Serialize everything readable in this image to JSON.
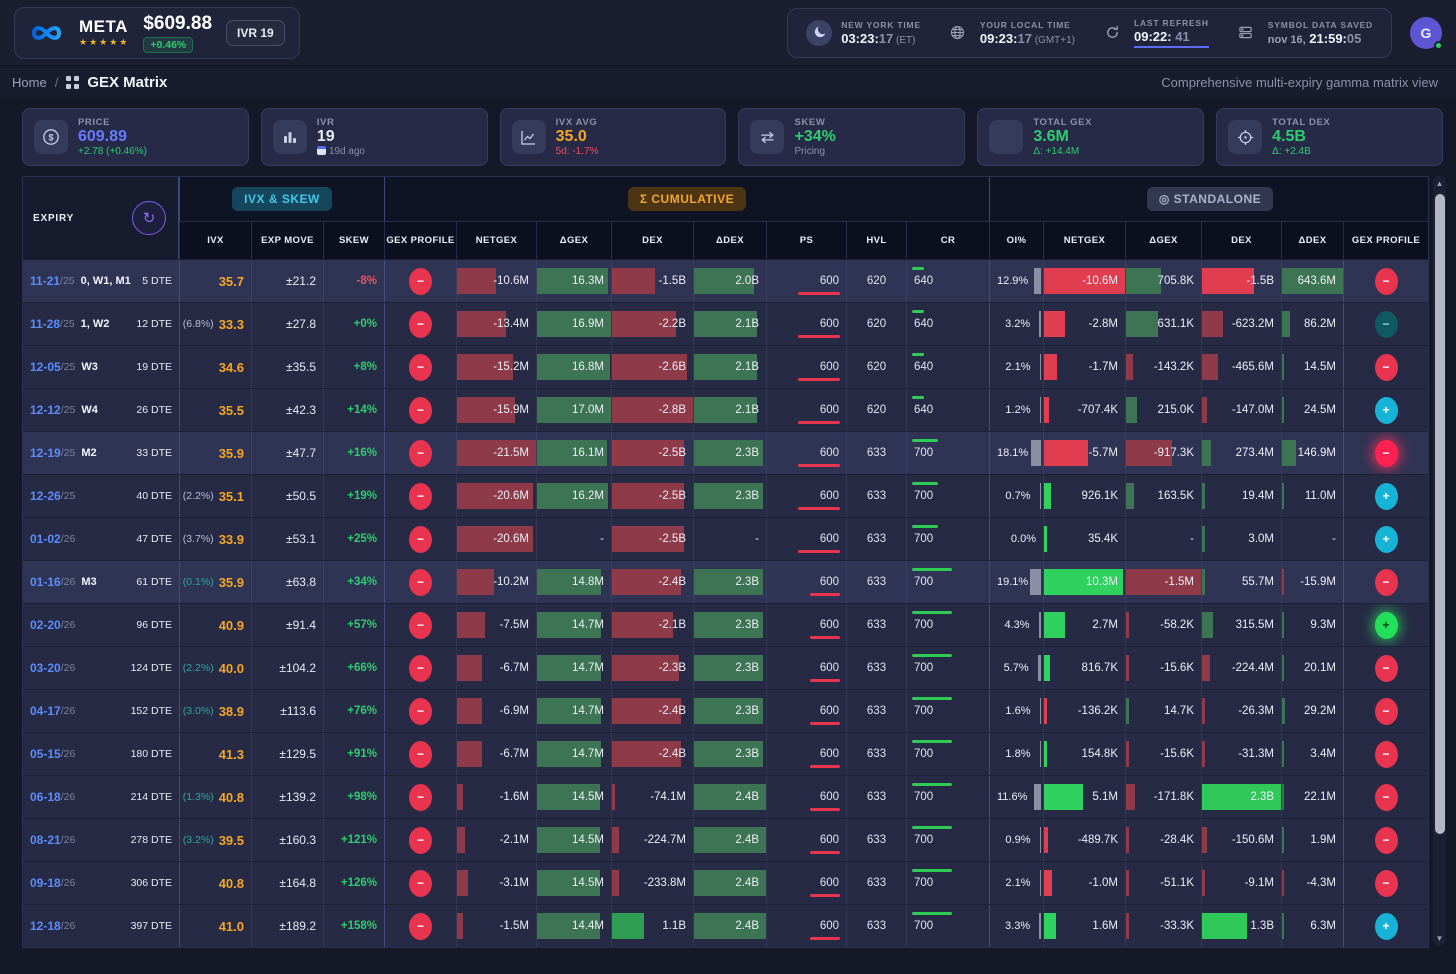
{
  "header": {
    "symbol": "META",
    "stars": "★★★★★",
    "price": "$609.88",
    "change_pct": "+0.46%",
    "ivr_badge": "IVR 19",
    "avatar": "G",
    "clocks": [
      {
        "icon": "moon-icon",
        "style": "round",
        "label": "NEW YORK TIME",
        "pre": "",
        "main": "03:23:",
        "dim": "17",
        "suffix": "(ET)",
        "underline": false
      },
      {
        "icon": "globe-icon",
        "style": "flat",
        "label": "YOUR LOCAL TIME",
        "pre": "",
        "main": "09:23:",
        "dim": "17",
        "suffix": "(GMT+1)",
        "underline": false
      },
      {
        "icon": "refresh-icon",
        "style": "flat",
        "label": "LAST REFRESH",
        "pre": "",
        "main": "09:22:",
        "dim": " 41",
        "suffix": "",
        "underline": true
      },
      {
        "icon": "server-icon",
        "style": "flat",
        "label": "SYMBOL DATA SAVED",
        "pre": "nov 16,",
        "main": " 21:59:",
        "dim": "05",
        "suffix": "",
        "underline": false
      }
    ]
  },
  "breadcrumb": {
    "home": "Home",
    "sep": "/",
    "title": "GEX Matrix",
    "subtitle": "Comprehensive multi-expiry gamma matrix view"
  },
  "cards": [
    {
      "icon": "dollar-icon",
      "label": "PRICE",
      "value": "609.89",
      "value_class": "v-indigo",
      "sub": "+2.78 (+0.46%)",
      "sub_class": "s-green"
    },
    {
      "icon": "bars-icon",
      "label": "IVR",
      "value": "19",
      "value_class": "v-white",
      "sub": "19d ago",
      "sub_class": "s-gray",
      "sub_icon": "calendar-icon"
    },
    {
      "icon": "chart-icon",
      "label": "IVX AVG",
      "value": "35.0",
      "value_class": "v-orange",
      "sub": "5d: -1.7%",
      "sub_class": "s-red"
    },
    {
      "icon": "arrows-icon",
      "label": "SKEW",
      "value": "+34%",
      "value_class": "v-green",
      "sub": "Pricing",
      "sub_class": "s-gray"
    },
    {
      "icon": "square-icon",
      "label": "TOTAL GEX",
      "value": "3.6M",
      "value_class": "v-green",
      "sub": "Δ: +14.4M",
      "sub_class": "s-green"
    },
    {
      "icon": "target-icon",
      "label": "TOTAL DEX",
      "value": "4.5B",
      "value_class": "v-green",
      "sub": "Δ: +2.4B",
      "sub_class": "s-green"
    }
  ],
  "table": {
    "expiry_label": "EXPIRY",
    "groups": {
      "ivx_skew": "IVX & SKEW",
      "cumulative": "Σ CUMULATIVE",
      "standalone": "◎ STANDALONE"
    },
    "columns": [
      "IVX",
      "EXP MOVE",
      "SKEW",
      "GEX PROFILE",
      "NETGEX",
      "ΔGEX",
      "DEX",
      "ΔDEX",
      "PS",
      "HVL",
      "CR",
      "OI%",
      "NETGEX",
      "ΔGEX",
      "DEX",
      "ΔDEX",
      "GEX PROFILE"
    ],
    "scales": {
      "c_net": 21500000,
      "c_dg": 17000000,
      "c_dex": 2800000000,
      "c_dd": 2400000000,
      "s_net": 10600000,
      "s_dg": 1500000,
      "s_dex": 2300000000,
      "s_dd": 643600000,
      "oi": 19.1
    },
    "rows": [
      {
        "date": "11-21",
        "yy": "/25",
        "tags": "0, W1, M1",
        "dte": "5 DTE",
        "ivx_pct": "",
        "pct_class": "",
        "ivx": "35.7",
        "em": "±21.2",
        "skew": "-8%",
        "skew_neg": true,
        "cprof": "rm",
        "c_net": "-10.6M",
        "c_dg": "16.3M",
        "c_dex": "-1.5B",
        "c_dd": "2.0B",
        "ps": "600",
        "hvl": "620",
        "cr": "640",
        "crw": 12,
        "psw": 42,
        "oi": "12.9%",
        "s_net": "-10.6M",
        "s_dg": "705.8K",
        "s_dex": "-1.5B",
        "s_dd": "643.6M",
        "sprof": "rm",
        "hl": true
      },
      {
        "date": "11-28",
        "yy": "/25",
        "tags": "1, W2",
        "dte": "12 DTE",
        "ivx_pct": "(6.8%)",
        "pct_class": "pc-lav",
        "ivx": "33.3",
        "em": "±27.8",
        "skew": "+0%",
        "skew_neg": false,
        "cprof": "rm",
        "c_net": "-13.4M",
        "c_dg": "16.9M",
        "c_dex": "-2.2B",
        "c_dd": "2.1B",
        "ps": "600",
        "hvl": "620",
        "cr": "640",
        "crw": 12,
        "psw": 42,
        "oi": "3.2%",
        "s_net": "-2.8M",
        "s_dg": "631.1K",
        "s_dex": "-623.2M",
        "s_dd": "86.2M",
        "sprof": "tm",
        "hl": false
      },
      {
        "date": "12-05",
        "yy": "/25",
        "tags": "W3",
        "dte": "19 DTE",
        "ivx_pct": "",
        "pct_class": "",
        "ivx": "34.6",
        "em": "±35.5",
        "skew": "+8%",
        "skew_neg": false,
        "cprof": "rm",
        "c_net": "-15.2M",
        "c_dg": "16.8M",
        "c_dex": "-2.6B",
        "c_dd": "2.1B",
        "ps": "600",
        "hvl": "620",
        "cr": "640",
        "crw": 12,
        "psw": 42,
        "oi": "2.1%",
        "s_net": "-1.7M",
        "s_dg": "-143.2K",
        "s_dex": "-465.6M",
        "s_dd": "14.5M",
        "sprof": "rm",
        "hl": false
      },
      {
        "date": "12-12",
        "yy": "/25",
        "tags": "W4",
        "dte": "26 DTE",
        "ivx_pct": "",
        "pct_class": "",
        "ivx": "35.5",
        "em": "±42.3",
        "skew": "+14%",
        "skew_neg": false,
        "cprof": "rm",
        "c_net": "-15.9M",
        "c_dg": "17.0M",
        "c_dex": "-2.8B",
        "c_dd": "2.1B",
        "ps": "600",
        "hvl": "620",
        "cr": "640",
        "crw": 12,
        "psw": 42,
        "oi": "1.2%",
        "s_net": "-707.4K",
        "s_dg": "215.0K",
        "s_dex": "-147.0M",
        "s_dd": "24.5M",
        "sprof": "cp",
        "hl": false
      },
      {
        "date": "12-19",
        "yy": "/25",
        "tags": "M2",
        "dte": "33 DTE",
        "ivx_pct": "",
        "pct_class": "",
        "ivx": "35.9",
        "em": "±47.7",
        "skew": "+16%",
        "skew_neg": false,
        "cprof": "rm",
        "c_net": "-21.5M",
        "c_dg": "16.1M",
        "c_dex": "-2.5B",
        "c_dd": "2.3B",
        "ps": "600",
        "hvl": "633",
        "cr": "700",
        "crw": 26,
        "psw": 42,
        "oi": "18.1%",
        "s_net": "-5.7M",
        "s_dg": "-917.3K",
        "s_dex": "273.4M",
        "s_dd": "146.9M",
        "sprof": "rg",
        "hl": true
      },
      {
        "date": "12-26",
        "yy": "/25",
        "tags": "",
        "dte": "40 DTE",
        "ivx_pct": "(2.2%)",
        "pct_class": "pc-lav",
        "ivx": "35.1",
        "em": "±50.5",
        "skew": "+19%",
        "skew_neg": false,
        "cprof": "rm",
        "c_net": "-20.6M",
        "c_dg": "16.2M",
        "c_dex": "-2.5B",
        "c_dd": "2.3B",
        "ps": "600",
        "hvl": "633",
        "cr": "700",
        "crw": 26,
        "psw": 42,
        "oi": "0.7%",
        "s_net": "926.1K",
        "s_dg": "163.5K",
        "s_dex": "19.4M",
        "s_dd": "11.0M",
        "sprof": "cp",
        "hl": false
      },
      {
        "date": "01-02",
        "yy": "/26",
        "tags": "",
        "dte": "47 DTE",
        "ivx_pct": "(3.7%)",
        "pct_class": "pc-lav",
        "ivx": "33.9",
        "em": "±53.1",
        "skew": "+25%",
        "skew_neg": false,
        "cprof": "rm",
        "c_net": "-20.6M",
        "c_dg": "-",
        "c_dex": "-2.5B",
        "c_dd": "-",
        "ps": "600",
        "hvl": "633",
        "cr": "700",
        "crw": 26,
        "psw": 42,
        "oi": "0.0%",
        "s_net": "35.4K",
        "s_dg": "-",
        "s_dex": "3.0M",
        "s_dd": "-",
        "sprof": "cp",
        "hl": false
      },
      {
        "date": "01-16",
        "yy": "/26",
        "tags": "M3",
        "dte": "61 DTE",
        "ivx_pct": "(0.1%)",
        "pct_class": "pc-teal",
        "ivx": "35.9",
        "em": "±63.8",
        "skew": "+34%",
        "skew_neg": false,
        "cprof": "rm",
        "c_net": "-10.2M",
        "c_dg": "14.8M",
        "c_dex": "-2.4B",
        "c_dd": "2.3B",
        "ps": "600",
        "hvl": "633",
        "cr": "700",
        "crw": 40,
        "psw": 30,
        "oi": "19.1%",
        "s_net": "10.3M",
        "s_dg": "-1.5M",
        "s_dex": "55.7M",
        "s_dd": "-15.9M",
        "sprof": "rm",
        "hl": true
      },
      {
        "date": "02-20",
        "yy": "/26",
        "tags": "",
        "dte": "96 DTE",
        "ivx_pct": "",
        "pct_class": "",
        "ivx": "40.9",
        "em": "±91.4",
        "skew": "+57%",
        "skew_neg": false,
        "cprof": "rm",
        "c_net": "-7.5M",
        "c_dg": "14.7M",
        "c_dex": "-2.1B",
        "c_dd": "2.3B",
        "ps": "600",
        "hvl": "633",
        "cr": "700",
        "crw": 40,
        "psw": 30,
        "oi": "4.3%",
        "s_net": "2.7M",
        "s_dg": "-58.2K",
        "s_dex": "315.5M",
        "s_dd": "9.3M",
        "sprof": "gp",
        "hl": false
      },
      {
        "date": "03-20",
        "yy": "/26",
        "tags": "",
        "dte": "124 DTE",
        "ivx_pct": "(2.2%)",
        "pct_class": "pc-teal",
        "ivx": "40.0",
        "em": "±104.2",
        "skew": "+66%",
        "skew_neg": false,
        "cprof": "rm",
        "c_net": "-6.7M",
        "c_dg": "14.7M",
        "c_dex": "-2.3B",
        "c_dd": "2.3B",
        "ps": "600",
        "hvl": "633",
        "cr": "700",
        "crw": 40,
        "psw": 30,
        "oi": "5.7%",
        "s_net": "816.7K",
        "s_dg": "-15.6K",
        "s_dex": "-224.4M",
        "s_dd": "20.1M",
        "sprof": "rm",
        "hl": false
      },
      {
        "date": "04-17",
        "yy": "/26",
        "tags": "",
        "dte": "152 DTE",
        "ivx_pct": "(3.0%)",
        "pct_class": "pc-teal",
        "ivx": "38.9",
        "em": "±113.6",
        "skew": "+76%",
        "skew_neg": false,
        "cprof": "rm",
        "c_net": "-6.9M",
        "c_dg": "14.7M",
        "c_dex": "-2.4B",
        "c_dd": "2.3B",
        "ps": "600",
        "hvl": "633",
        "cr": "700",
        "crw": 40,
        "psw": 30,
        "oi": "1.6%",
        "s_net": "-136.2K",
        "s_dg": "14.7K",
        "s_dex": "-26.3M",
        "s_dd": "29.2M",
        "sprof": "rm",
        "hl": false
      },
      {
        "date": "05-15",
        "yy": "/26",
        "tags": "",
        "dte": "180 DTE",
        "ivx_pct": "",
        "pct_class": "",
        "ivx": "41.3",
        "em": "±129.5",
        "skew": "+91%",
        "skew_neg": false,
        "cprof": "rm",
        "c_net": "-6.7M",
        "c_dg": "14.7M",
        "c_dex": "-2.4B",
        "c_dd": "2.3B",
        "ps": "600",
        "hvl": "633",
        "cr": "700",
        "crw": 40,
        "psw": 30,
        "oi": "1.8%",
        "s_net": "154.8K",
        "s_dg": "-15.6K",
        "s_dex": "-31.3M",
        "s_dd": "3.4M",
        "sprof": "rm",
        "hl": false
      },
      {
        "date": "06-18",
        "yy": "/26",
        "tags": "",
        "dte": "214 DTE",
        "ivx_pct": "(1.3%)",
        "pct_class": "pc-teal",
        "ivx": "40.8",
        "em": "±139.2",
        "skew": "+98%",
        "skew_neg": false,
        "cprof": "rm",
        "c_net": "-1.6M",
        "c_dg": "14.5M",
        "c_dex": "-74.1M",
        "c_dd": "2.4B",
        "ps": "600",
        "hvl": "633",
        "cr": "700",
        "crw": 40,
        "psw": 30,
        "oi": "11.6%",
        "s_net": "5.1M",
        "s_dg": "-171.8K",
        "s_dex": "2.3B",
        "s_dd": "22.1M",
        "sprof": "rm",
        "hl": false
      },
      {
        "date": "08-21",
        "yy": "/26",
        "tags": "",
        "dte": "278 DTE",
        "ivx_pct": "(3.2%)",
        "pct_class": "pc-teal",
        "ivx": "39.5",
        "em": "±160.3",
        "skew": "+121%",
        "skew_neg": false,
        "cprof": "rm",
        "c_net": "-2.1M",
        "c_dg": "14.5M",
        "c_dex": "-224.7M",
        "c_dd": "2.4B",
        "ps": "600",
        "hvl": "633",
        "cr": "700",
        "crw": 40,
        "psw": 30,
        "oi": "0.9%",
        "s_net": "-489.7K",
        "s_dg": "-28.4K",
        "s_dex": "-150.6M",
        "s_dd": "1.9M",
        "sprof": "rm",
        "hl": false
      },
      {
        "date": "09-18",
        "yy": "/26",
        "tags": "",
        "dte": "306 DTE",
        "ivx_pct": "",
        "pct_class": "",
        "ivx": "40.8",
        "em": "±164.8",
        "skew": "+126%",
        "skew_neg": false,
        "cprof": "rm",
        "c_net": "-3.1M",
        "c_dg": "14.5M",
        "c_dex": "-233.8M",
        "c_dd": "2.4B",
        "ps": "600",
        "hvl": "633",
        "cr": "700",
        "crw": 40,
        "psw": 30,
        "oi": "2.1%",
        "s_net": "-1.0M",
        "s_dg": "-51.1K",
        "s_dex": "-9.1M",
        "s_dd": "-4.3M",
        "sprof": "rm",
        "hl": false
      },
      {
        "date": "12-18",
        "yy": "/26",
        "tags": "",
        "dte": "397 DTE",
        "ivx_pct": "",
        "pct_class": "",
        "ivx": "41.0",
        "em": "±189.2",
        "skew": "+158%",
        "skew_neg": false,
        "cprof": "rm",
        "c_net": "-1.5M",
        "c_dg": "14.4M",
        "c_dex": "1.1B",
        "c_dd": "2.4B",
        "ps": "600",
        "hvl": "633",
        "cr": "700",
        "crw": 40,
        "psw": 30,
        "oi": "3.3%",
        "s_net": "1.6M",
        "s_dg": "-33.3K",
        "s_dex": "1.3B",
        "s_dd": "6.3M",
        "sprof": "cp",
        "hl": false
      }
    ]
  }
}
